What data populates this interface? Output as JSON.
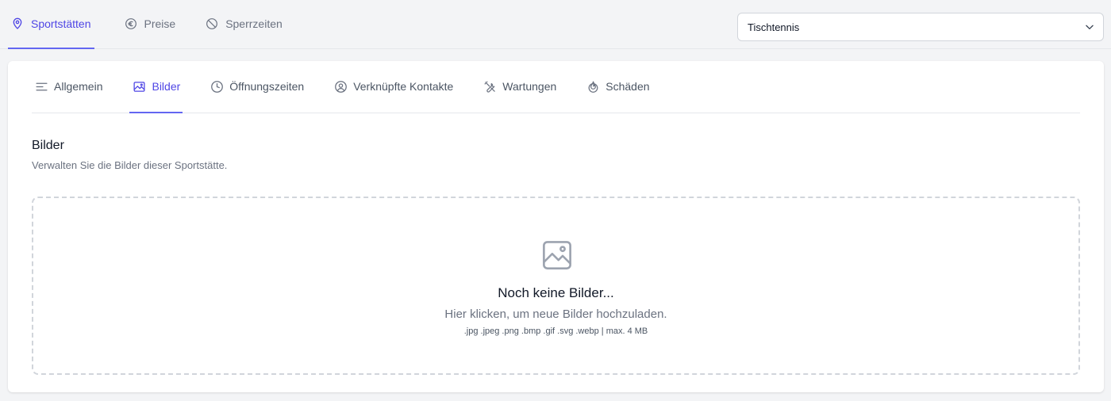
{
  "top_nav": {
    "tabs": [
      {
        "label": "Sportstätten",
        "icon": "map-pin-icon",
        "active": true
      },
      {
        "label": "Preise",
        "icon": "euro-icon",
        "active": false
      },
      {
        "label": "Sperrzeiten",
        "icon": "ban-icon",
        "active": false
      }
    ]
  },
  "sport_select": {
    "value": "Tischtennis"
  },
  "sub_nav": {
    "tabs": [
      {
        "label": "Allgemein",
        "icon": "align-left-icon",
        "active": false
      },
      {
        "label": "Bilder",
        "icon": "image-icon",
        "active": true
      },
      {
        "label": "Öffnungszeiten",
        "icon": "clock-icon",
        "active": false
      },
      {
        "label": "Verknüpfte Kontakte",
        "icon": "user-circle-icon",
        "active": false
      },
      {
        "label": "Wartungen",
        "icon": "tools-icon",
        "active": false
      },
      {
        "label": "Schäden",
        "icon": "flame-icon",
        "active": false
      }
    ]
  },
  "section": {
    "title": "Bilder",
    "description": "Verwalten Sie die Bilder dieser Sportstätte."
  },
  "dropzone": {
    "icon": "image-icon",
    "title": "Noch keine Bilder...",
    "subtitle": "Hier klicken, um neue Bilder hochzuladen.",
    "hint": ".jpg .jpeg .png .bmp .gif .svg .webp | max. 4 MB"
  },
  "colors": {
    "accent": "#4f46e5",
    "background": "#f3f4f6",
    "card": "#ffffff",
    "muted_text": "#6b7280"
  }
}
